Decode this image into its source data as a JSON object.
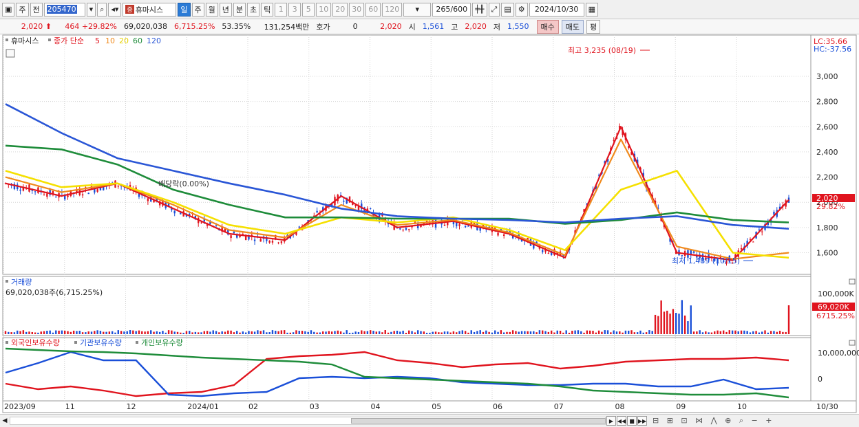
{
  "toolbar": {
    "market": "주",
    "prev": "전",
    "code": "205470",
    "name_tag": "증",
    "name": "휴마시스",
    "periods": [
      "일",
      "주",
      "월",
      "년",
      "분",
      "초",
      "틱"
    ],
    "selected_period": "일",
    "intervals": [
      "1",
      "3",
      "5",
      "10",
      "20",
      "30",
      "60",
      "120"
    ],
    "count": "265",
    "count_total": "/600",
    "date": "2024/10/30"
  },
  "info": {
    "price": "2,020",
    "change": "464",
    "change_pct": "+29.82%",
    "volume": "69,020,038",
    "vol_pct": "6,715.25%",
    "rate": "53.35%",
    "amount": "131,254백만",
    "quote_label": "호가",
    "quote_value": "0",
    "close": "2,020",
    "open_label": "시",
    "open": "1,561",
    "high_label": "고",
    "high": "2,020",
    "low_label": "저",
    "low": "1,550",
    "buy_label": "매수",
    "sell_label": "매도",
    "avg_label": "평"
  },
  "price_panel": {
    "legend_name": "휴마시스",
    "legend_series": "종가 단순",
    "ma_periods": [
      "5",
      "10",
      "20",
      "60",
      "120"
    ],
    "lc": "LC:35.66",
    "hc": "HC:-37.56",
    "axis_ticks": [
      "3,000",
      "2,800",
      "2,600",
      "2,400",
      "2,200",
      "2,000",
      "1,800",
      "1,600"
    ],
    "price_tag": "2,020",
    "pct_tag": "29.82%",
    "high_annotation": "최고 3,235 (08/19)",
    "low_annotation": "최저 1,489 (10/15)",
    "ex_div": "배당락(0.00%)"
  },
  "volume_panel": {
    "title": "거래량",
    "value": "69,020,038주(6,715.25%)",
    "axis_tick": "100,000K",
    "tag": "69,020K",
    "tag_pct": "6715.25%"
  },
  "holdings_panel": {
    "legend": [
      "외국인보유수량",
      "기관보유수량",
      "개인보유수량"
    ],
    "axis_ticks": [
      "10,000,000",
      "0"
    ]
  },
  "x_axis": {
    "labels": [
      "2023/09",
      "11",
      "12",
      "2024/01",
      "02",
      "03",
      "04",
      "05",
      "06",
      "07",
      "08",
      "09",
      "10"
    ],
    "end_label": "10/30"
  },
  "colors": {
    "ma5": "#e0141e",
    "ma10": "#f08a1c",
    "ma20": "#f5e000",
    "ma60": "#1e8c3a",
    "ma120": "#2a56d6",
    "up": "#e0141e",
    "down": "#1a4fd8"
  },
  "chart_data": {
    "type": "line",
    "title": "",
    "ylim": [
      1450,
      3300
    ],
    "x": [
      "2023/09",
      "11",
      "12",
      "2024/01",
      "02",
      "03",
      "04",
      "05",
      "06",
      "07",
      "08",
      "09",
      "10",
      "10/30"
    ],
    "series": [
      {
        "name": "5",
        "values": [
          2150,
          2050,
          2150,
          1950,
          1750,
          1700,
          2050,
          1800,
          1850,
          1750,
          1560,
          2600,
          1600,
          1540,
          2020
        ]
      },
      {
        "name": "10",
        "values": [
          2200,
          2080,
          2150,
          1980,
          1780,
          1720,
          1980,
          1820,
          1860,
          1760,
          1580,
          2500,
          1650,
          1550,
          1600
        ]
      },
      {
        "name": "20",
        "values": [
          2250,
          2120,
          2150,
          2000,
          1820,
          1750,
          1880,
          1840,
          1880,
          1780,
          1620,
          2100,
          2250,
          1600,
          1560
        ]
      },
      {
        "name": "60",
        "values": [
          2450,
          2420,
          2300,
          2100,
          1980,
          1880,
          1880,
          1870,
          1870,
          1870,
          1830,
          1860,
          1920,
          1860,
          1840
        ]
      },
      {
        "name": "120",
        "values": [
          2780,
          2550,
          2350,
          2250,
          2150,
          2060,
          1950,
          1890,
          1870,
          1860,
          1840,
          1870,
          1890,
          1820,
          1790
        ]
      }
    ]
  }
}
